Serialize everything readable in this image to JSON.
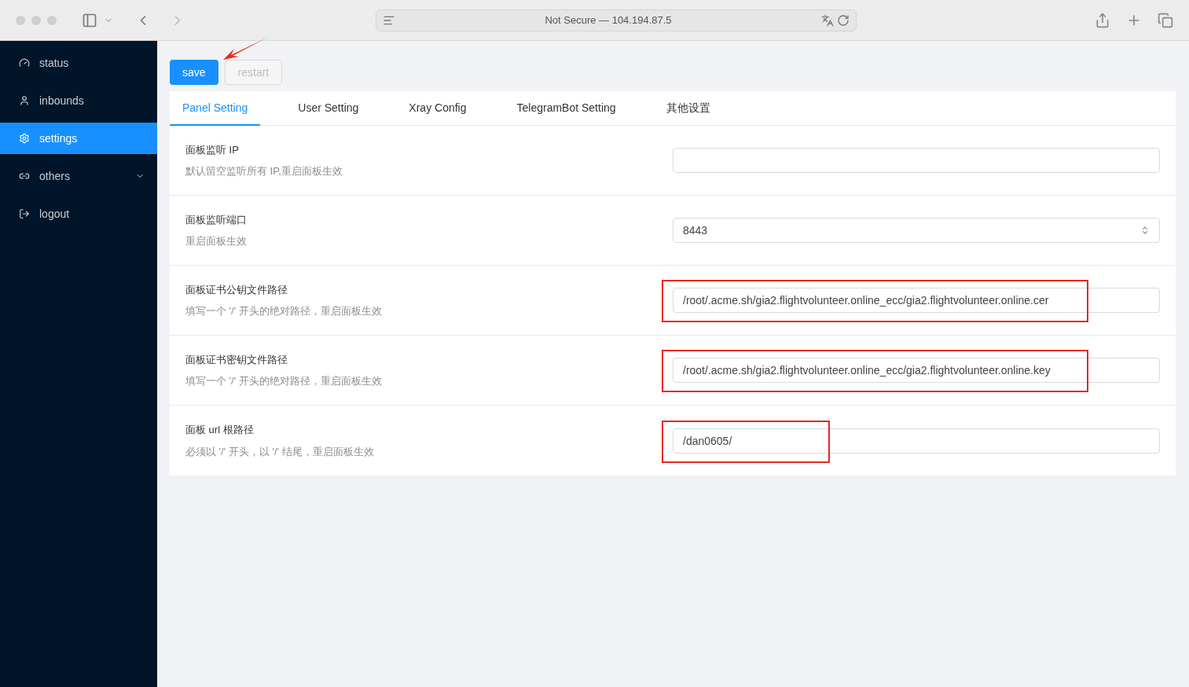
{
  "browser": {
    "address": "Not Secure — 104.194.87.5"
  },
  "sidebar": {
    "items": [
      {
        "label": "status",
        "selected": false,
        "expandable": false
      },
      {
        "label": "inbounds",
        "selected": false,
        "expandable": false
      },
      {
        "label": "settings",
        "selected": true,
        "expandable": false
      },
      {
        "label": "others",
        "selected": false,
        "expandable": true
      },
      {
        "label": "logout",
        "selected": false,
        "expandable": false
      }
    ]
  },
  "buttons": [
    {
      "label": "save",
      "disabled": false
    },
    {
      "label": "restart",
      "disabled": true
    }
  ],
  "annotation_arrow_shown": true,
  "tabs": [
    {
      "label": "Panel Setting",
      "selected": true
    },
    {
      "label": "User Setting",
      "selected": false
    },
    {
      "label": "Xray Config",
      "selected": false
    },
    {
      "label": "TelegramBot Setting",
      "selected": false
    },
    {
      "label": "其他设置",
      "selected": false
    }
  ],
  "settings": [
    {
      "title": "面板监听 IP",
      "description": "默认留空监听所有 IP,重启面板生效",
      "kind": "text",
      "highlighted": false
    },
    {
      "title": "面板监听端口",
      "description": "重启面板生效",
      "kind": "number",
      "value": "8443",
      "highlighted": false
    },
    {
      "title": "面板证书公钥文件路径",
      "description": "填写一个 '/' 开头的绝对路径，重启面板生效",
      "kind": "text",
      "value": "/root/.acme.sh/gia2.flightvolunteer.online_ecc/gia2.flightvolunteer.online.cer",
      "highlighted": true
    },
    {
      "title": "面板证书密钥文件路径",
      "description": "填写一个 '/' 开头的绝对路径，重启面板生效",
      "kind": "text",
      "value": "/root/.acme.sh/gia2.flightvolunteer.online_ecc/gia2.flightvolunteer.online.key",
      "highlighted": true
    },
    {
      "title": "面板 url 根路径",
      "description": "必须以 '/' 开头，以 '/' 结尾，重启面板生效",
      "kind": "text",
      "value": "/dan0605/",
      "highlighted": true
    }
  ]
}
